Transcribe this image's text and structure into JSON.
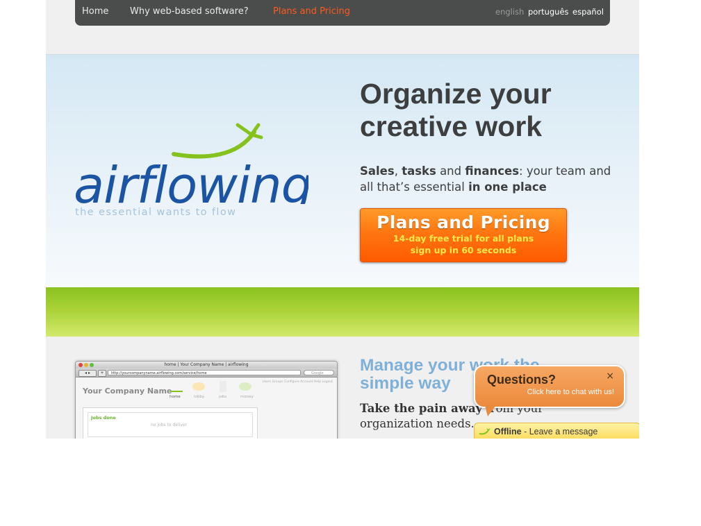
{
  "nav": {
    "items": [
      {
        "label": "Home"
      },
      {
        "label": "Why web-based software?"
      },
      {
        "label": "Plans and Pricing",
        "active": true
      }
    ],
    "languages": [
      {
        "label": "english",
        "current": true
      },
      {
        "label": "português"
      },
      {
        "label": "español"
      }
    ]
  },
  "brand": {
    "name": "airflowing",
    "tagline": "the essential wants to flow",
    "colors": {
      "logo_text": "#1c54a4",
      "logo_swoosh": "#86c21d",
      "accent_orange": "#ff5a1a"
    }
  },
  "hero": {
    "headline_line1": "Organize your",
    "headline_line2": "creative work",
    "sub": {
      "sales": "Sales",
      "sep1": ", ",
      "tasks": "tasks",
      "and": " and ",
      "finances": "finances",
      "rest": ": your team and all that’s essential ",
      "one_place": "in one place"
    },
    "cta": {
      "title": "Plans and Pricing",
      "line1": "14-day free trial for all plans",
      "line2": "sign up in 60 seconds"
    }
  },
  "screenshot": {
    "window_title": "home | Your Company Name | airflowing",
    "url": "http://yourcompanyname.airflowing.com/service/home",
    "search_placeholder": "Google",
    "company": "Your Company Name",
    "tabs": [
      "home",
      "lobby",
      "jobs",
      "money"
    ],
    "links": "Users  Groups  Configure  Account  Help  Logout",
    "panel_title": "Jobs done",
    "panel_empty": "no jobs to deliver"
  },
  "lower": {
    "manage_line1": "Manage your work the",
    "manage_line2": "simple way",
    "pain_bold": "Take the pain away",
    "pain_rest": " from your organization needs."
  },
  "chat": {
    "title": "Questions?",
    "close": "×",
    "subtitle": "Click here to chat with us!",
    "status": "Offline",
    "status_rest": " - Leave a message"
  }
}
